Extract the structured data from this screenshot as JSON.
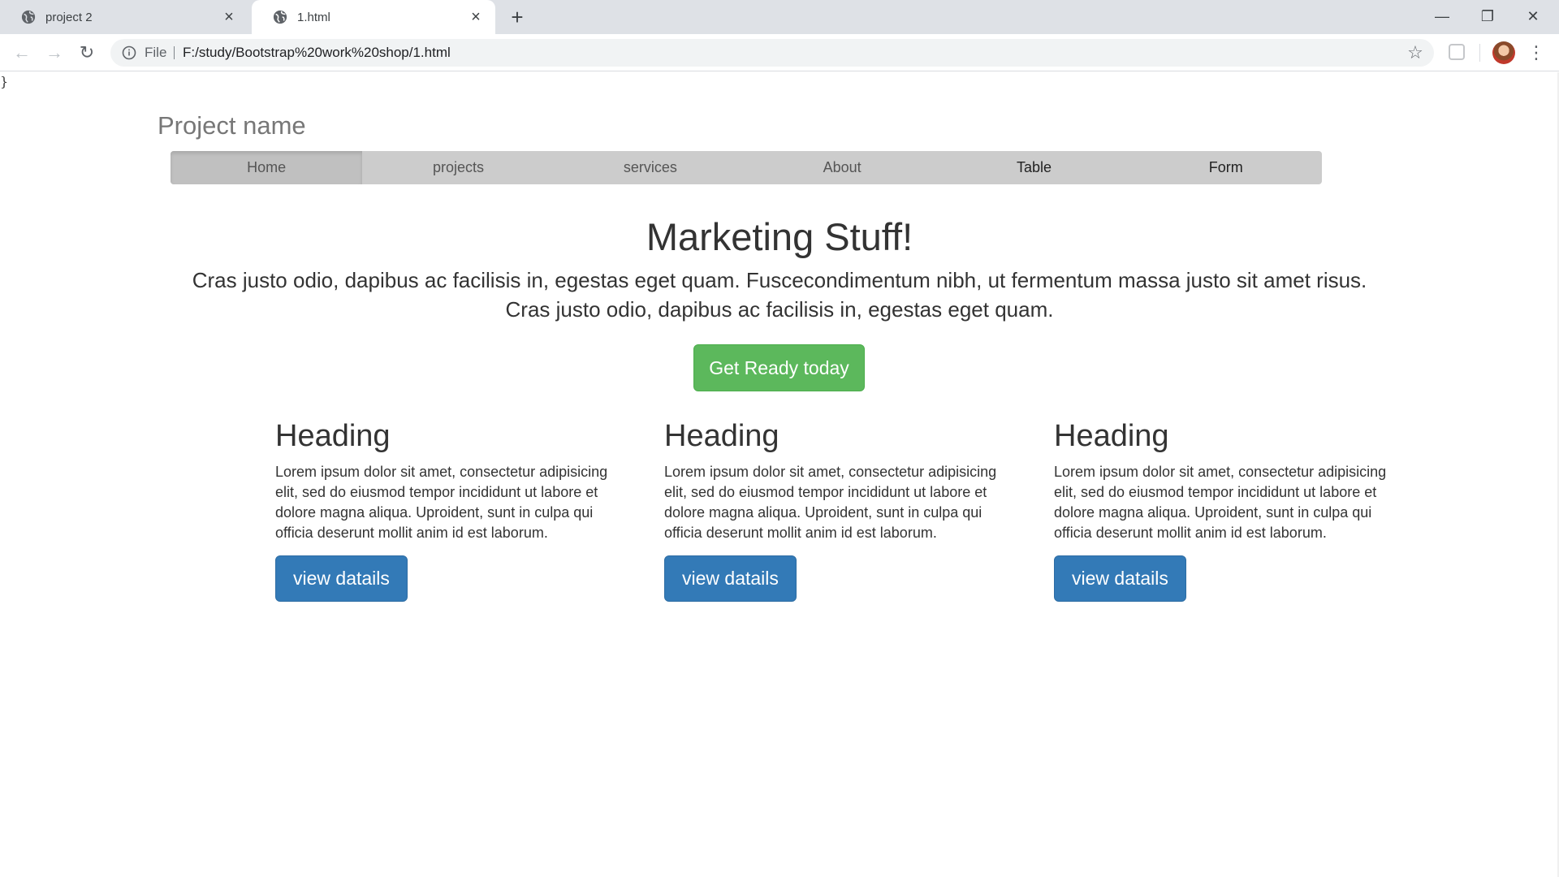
{
  "browser": {
    "tabs": [
      {
        "title": "project 2",
        "active": false
      },
      {
        "title": "1.html",
        "active": true
      }
    ],
    "address": {
      "scheme": "File",
      "url": "F:/study/Bootstrap%20work%20shop/1.html"
    }
  },
  "page": {
    "stray_text": "}",
    "brand": "Project name",
    "nav": [
      "Home",
      "projects",
      "services",
      "About",
      "Table",
      "Form"
    ],
    "hero": {
      "title": "Marketing Stuff!",
      "lead_line1": "Cras justo odio, dapibus ac facilisis in, egestas eget quam. Fuscecondimentum nibh, ut fermentum massa justo sit amet risus.",
      "lead_line2": "Cras justo odio, dapibus ac facilisis in, egestas eget quam.",
      "button": "Get Ready today"
    },
    "columns": [
      {
        "heading": "Heading",
        "text": "Lorem ipsum dolor sit amet, consectetur adipisicing elit, sed do eiusmod tempor incididunt ut labore et dolore magna aliqua. Uproident, sunt in culpa qui officia deserunt mollit anim id est laborum.",
        "button": "view datails"
      },
      {
        "heading": "Heading",
        "text": "Lorem ipsum dolor sit amet, consectetur adipisicing elit, sed do eiusmod tempor incididunt ut labore et dolore magna aliqua. Uproident, sunt in culpa qui officia deserunt mollit anim id est laborum.",
        "button": "view datails"
      },
      {
        "heading": "Heading",
        "text": "Lorem ipsum dolor sit amet, consectetur adipisicing elit, sed do eiusmod tempor incididunt ut labore et dolore magna aliqua. Uproident, sunt in culpa qui officia deserunt mollit anim id est laborum.",
        "button": "view datails"
      }
    ]
  },
  "colors": {
    "success": "#5cb85c",
    "primary": "#337ab7",
    "navbar": "#cccccc"
  }
}
